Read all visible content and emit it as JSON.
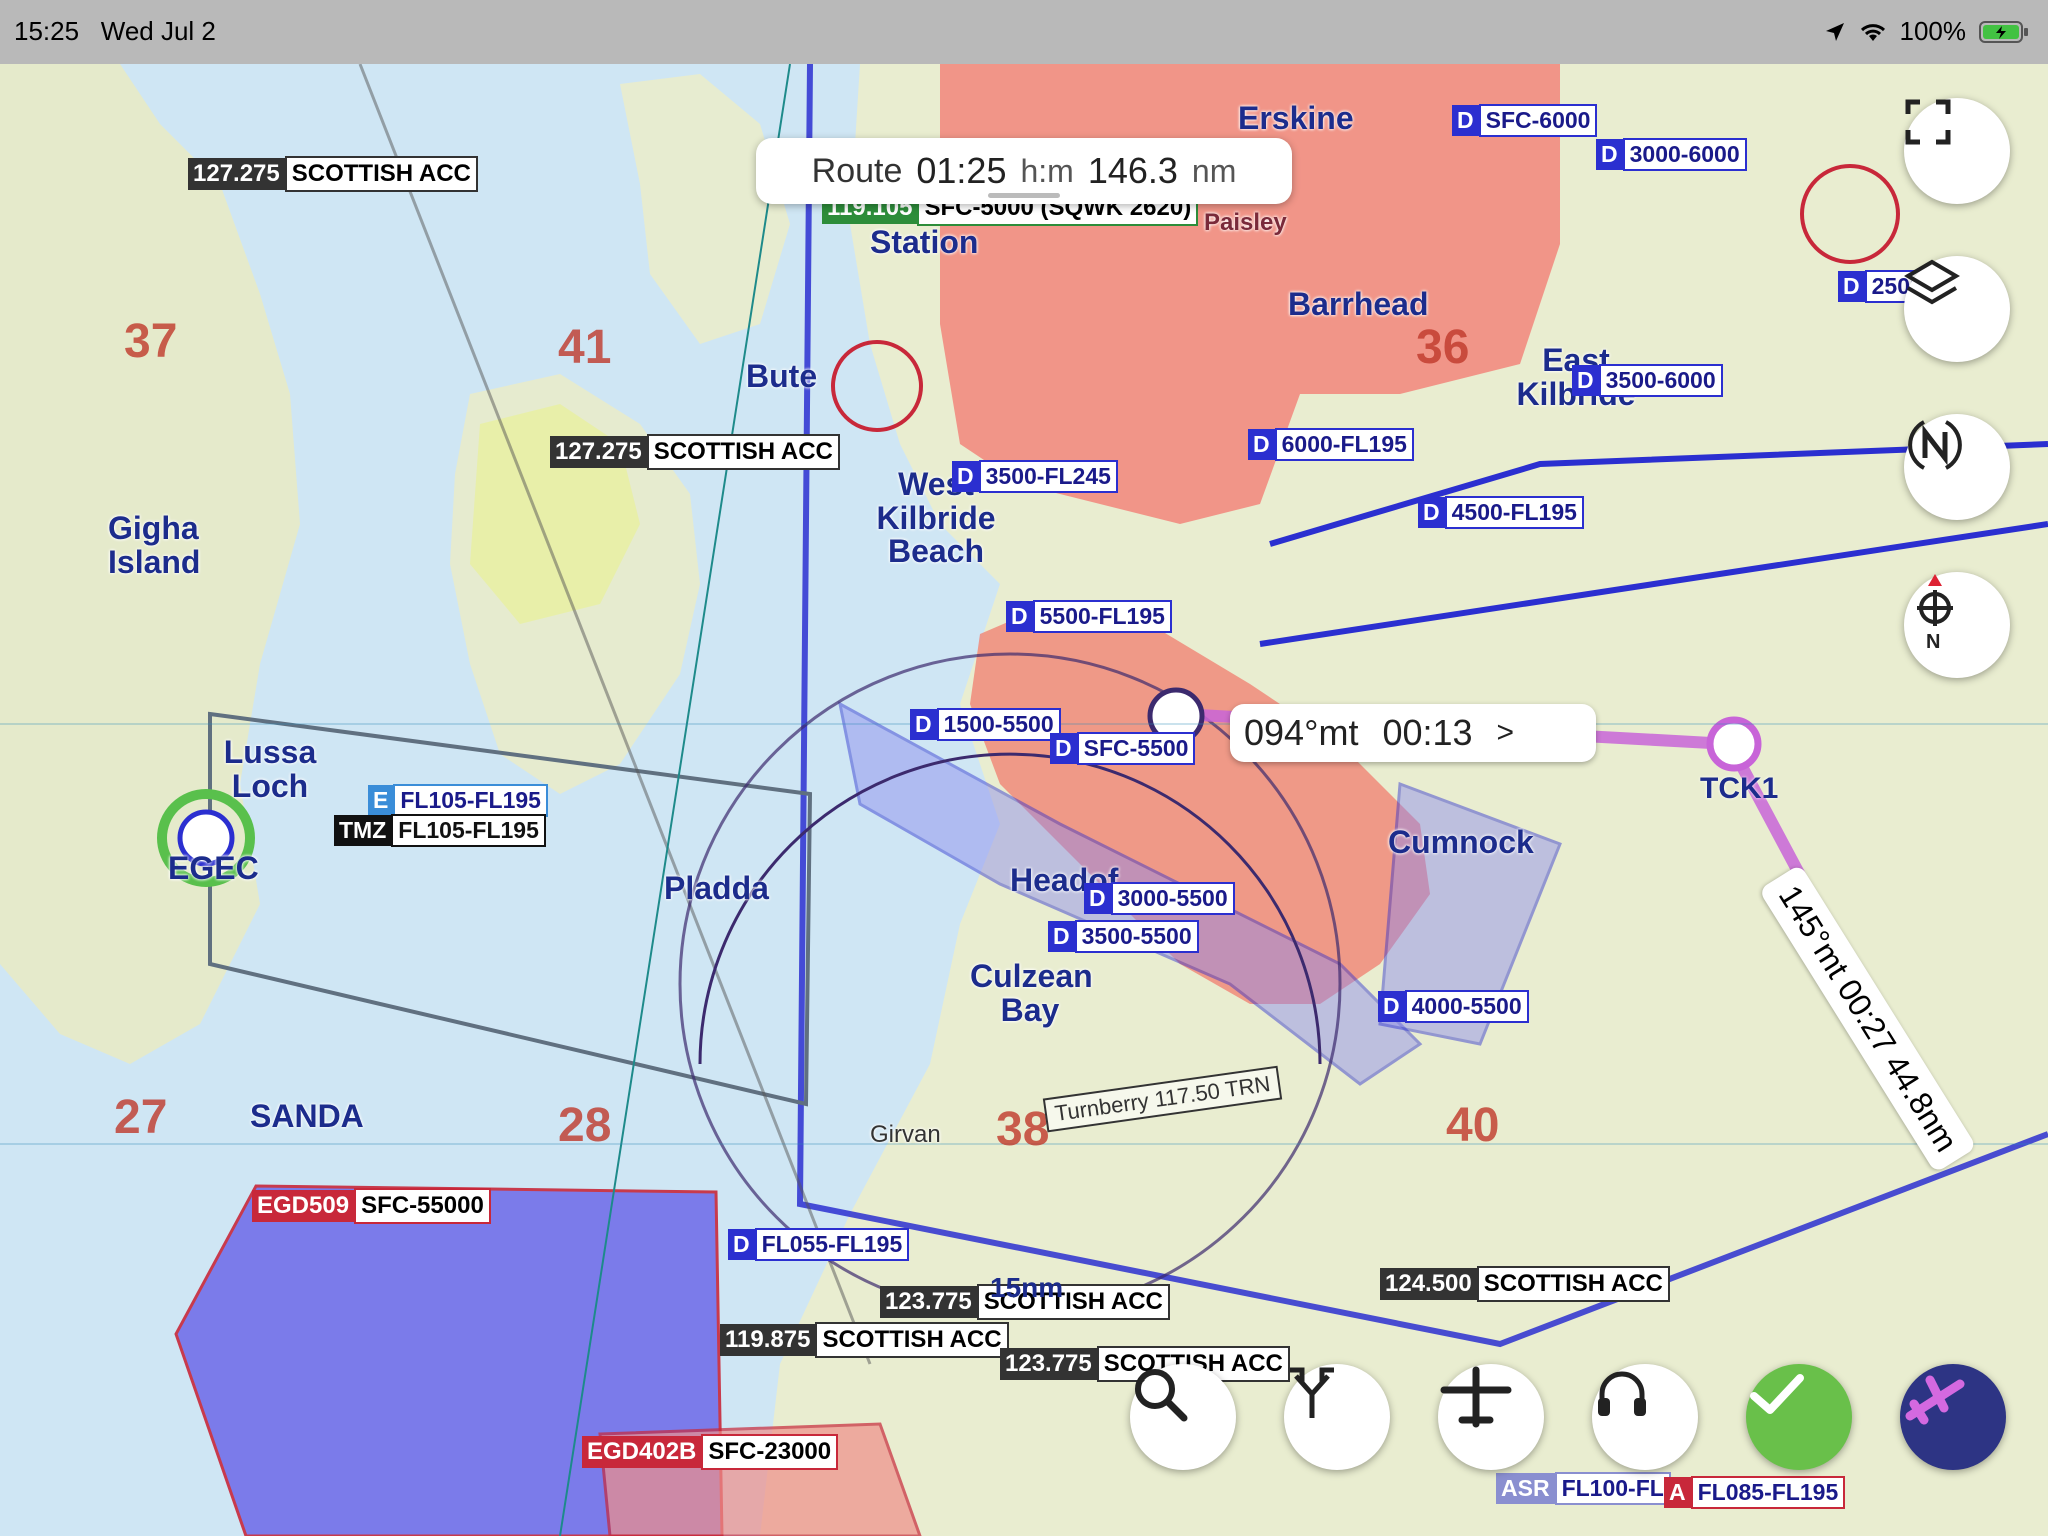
{
  "status_bar": {
    "time": "15:25",
    "date": "Wed Jul 2",
    "battery": "100%"
  },
  "route": {
    "label": "Route",
    "time": "01:25",
    "time_unit": "h:m",
    "distance": "146.3",
    "distance_unit": "nm"
  },
  "leg": {
    "bearing": "094°mt",
    "time": "00:13",
    "arrow": ">"
  },
  "leg2": {
    "text": "145°mt  00:27  44.8nm"
  },
  "waypoint": "TCK1",
  "freq_labels": [
    {
      "freq": "127.275",
      "name": "SCOTTISH ACC"
    },
    {
      "freq": "127.275",
      "name": "SCOTTISH ACC"
    },
    {
      "freq": "124.500",
      "name": "SCOTTISH ACC"
    },
    {
      "freq": "123.775",
      "name": "SCOTTISH ACC"
    },
    {
      "freq": "119.875",
      "name": "SCOTTISH ACC"
    },
    {
      "freq": "123.775",
      "name": "SCOTTISH ACC"
    }
  ],
  "restricted": [
    {
      "id": "EGD509",
      "limits": "SFC-55000"
    },
    {
      "id": "EGD402B",
      "limits": "SFC-23000"
    }
  ],
  "airspace_labels": [
    {
      "cls": "D",
      "limits": "SFC-6000"
    },
    {
      "cls": "D",
      "limits": "3000-6000"
    },
    {
      "cls": "D",
      "limits": "2500"
    },
    {
      "cls": "D",
      "limits": "3500-6000"
    },
    {
      "cls": "D",
      "limits": "6000-FL195"
    },
    {
      "cls": "D",
      "limits": "3500-FL245"
    },
    {
      "cls": "D",
      "limits": "4500-FL195"
    },
    {
      "cls": "D",
      "limits": "5500-FL195"
    },
    {
      "cls": "D",
      "limits": "1500-5500"
    },
    {
      "cls": "D",
      "limits": "SFC-5500"
    },
    {
      "cls": "E",
      "limits": "FL105-FL195"
    },
    {
      "cls": "TMZ",
      "limits": "FL105-FL195"
    },
    {
      "cls": "D",
      "limits": "3000-5500"
    },
    {
      "cls": "D",
      "limits": "3500-5500"
    },
    {
      "cls": "D",
      "limits": "4000-5500"
    },
    {
      "cls": "D",
      "limits": "FL055-FL195"
    },
    {
      "cls": "ASR",
      "limits": "FL100-FL"
    },
    {
      "cls": "A",
      "limits": "FL085-FL195"
    }
  ],
  "green_label": {
    "freq": "119.105",
    "text": "SFC-5000 (SQWK 2620)"
  },
  "places": [
    "Bute",
    "Station",
    "Erskine",
    "Barrhead",
    "East Kilbride",
    "Gigha Island",
    "West Kilbride Beach",
    "Lussa Loch",
    "EGEC",
    "Pladda",
    "SANDA",
    "Cumnock",
    "Headof",
    "Culzean Bay",
    "Turnberry",
    "Girvan",
    "Paisley"
  ],
  "grid_numbers": [
    "37",
    "41",
    "27",
    "28",
    "38",
    "40",
    "36"
  ],
  "scale": "15nm",
  "vor_box": "Turnberry 117.50 TRN",
  "buttons": [
    "fullscreen",
    "layers",
    "north-up",
    "locate",
    "search",
    "direct-to",
    "aircraft",
    "audio",
    "confirm",
    "plane-app"
  ],
  "colors": {
    "route": "#c864d8",
    "airspace_d": "#2b2fd0",
    "restricted": "#c8283a",
    "danger_fill": "#6f6fe8",
    "land": "#e8ecd2",
    "sea": "#cfe6f4",
    "urban": "#f07a74"
  }
}
